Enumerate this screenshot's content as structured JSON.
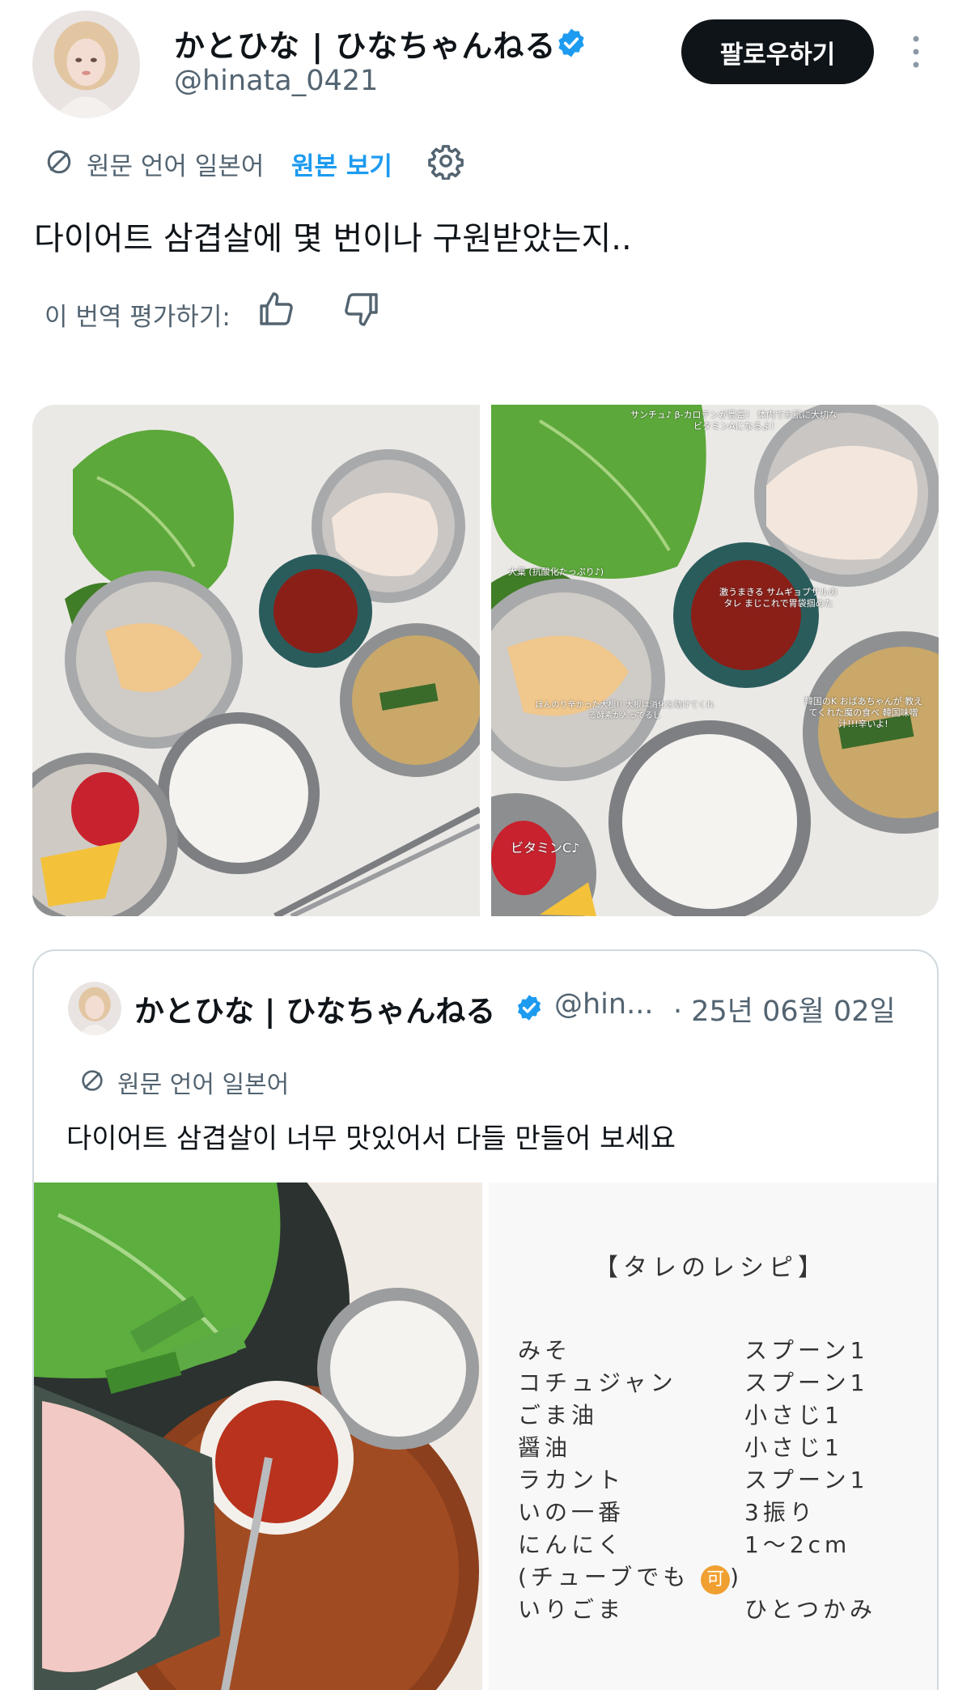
{
  "header": {
    "display_name": "かとひな | ひなちゃんねる",
    "handle": "@hinata_0421",
    "follow_label": "팔로우하기",
    "more_icon": "more-vertical-icon"
  },
  "translation": {
    "source_note": "원문 언어 일본어",
    "show_original": "원본 보기",
    "settings_icon": "gear-icon"
  },
  "tweet": {
    "text": "다이어트 삼겹살에 몇 번이나 구원받았는지..",
    "rate_label": "이 번역 평가하기:"
  },
  "media": {
    "image2_captions": {
      "top": "サンチュ♪ β-カロテンが豊富！ 体内でお肌に大切なビタミンAになるよ!",
      "perilla": "大葉 (抗酸化たっぷり♪)",
      "sauce": "激うまきる サムギョプサルのタレ まじこれで胃袋掴めた",
      "soup": "韓国のK おばあちゃんが 教えてくれた魔の食べ 韓国味噌汁!!!辛いよ!",
      "radish": "ほんのり辛かった大根!! 大根は消化を助けてくれる酵素が入ってるし",
      "fruit": "ビタミンC♪"
    }
  },
  "quote": {
    "display_name": "かとひな | ひなちゃんねる",
    "handle": "@hin...",
    "date": "· 25년 06월 02일",
    "source_note": "원문 언어 일본어",
    "text": "다이어트 삼겹살이 너무 맛있어서 다들 만들어 보세요"
  },
  "recipe": {
    "title": "【タレのレシピ】",
    "rows": [
      {
        "item": "みそ",
        "amount": "スプーン1"
      },
      {
        "item": "コチュジャン",
        "amount": "スプーン1"
      },
      {
        "item": "ごま油",
        "amount": "小さじ1"
      },
      {
        "item": "醤油",
        "amount": "小さじ1"
      },
      {
        "item": "ラカント",
        "amount": "スプーン1"
      },
      {
        "item": "いの一番",
        "amount": "3振り"
      },
      {
        "item": "にんにく",
        "amount": "1〜2cm"
      },
      {
        "item": "(チューブでも",
        "amount": ""
      },
      {
        "item": "いりごま",
        "amount": "ひとつかみ"
      }
    ],
    "badge": "可",
    "tube_close": ")"
  },
  "colors": {
    "accent": "#1d9bf0",
    "text_primary": "#0f1419",
    "text_secondary": "#536471",
    "border": "#cfd9de"
  }
}
